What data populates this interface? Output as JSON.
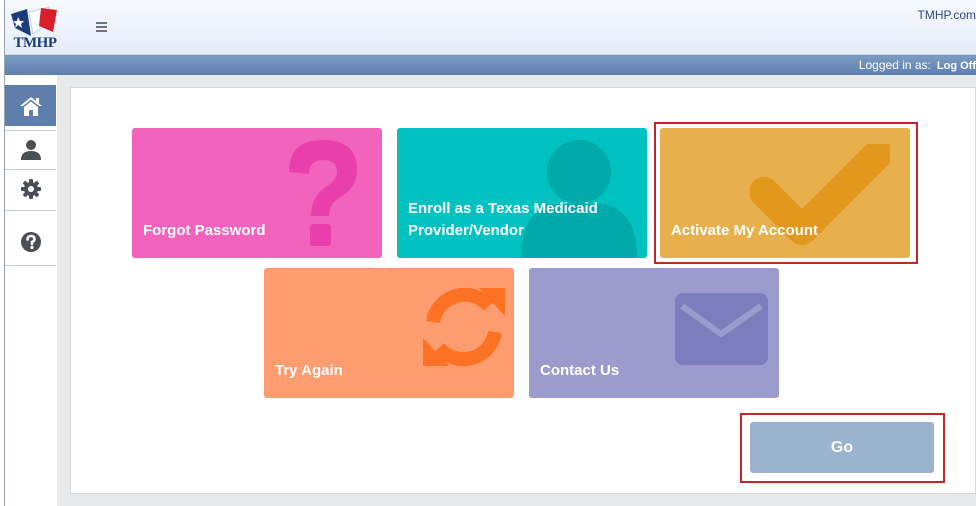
{
  "header": {
    "logo_text": "TMHP",
    "site_link": "TMHP.com"
  },
  "status_bar": {
    "logged_in_label": "Logged in as:",
    "log_off_label": "Log Off"
  },
  "sidenav": {
    "items": [
      {
        "name": "home",
        "icon": "home-icon",
        "active": true
      },
      {
        "name": "user",
        "icon": "user-icon",
        "active": false
      },
      {
        "name": "settings",
        "icon": "gear-icon",
        "active": false
      },
      {
        "name": "help",
        "icon": "question-icon",
        "active": false
      }
    ]
  },
  "tiles": {
    "forgot_password": {
      "label": "Forgot Password",
      "icon": "question-mark-icon",
      "color": "#f163bd"
    },
    "enroll": {
      "label_line1": "Enroll as a Texas Medicaid",
      "label_line2": "Provider/Vendor",
      "icon": "person-icon",
      "color": "#02c2c1"
    },
    "activate": {
      "label": "Activate My Account",
      "icon": "checkmark-icon",
      "color": "#e8b04d"
    },
    "try_again": {
      "label": "Try Again",
      "icon": "refresh-icon",
      "color": "#fd9c6e"
    },
    "contact_us": {
      "label": "Contact Us",
      "icon": "envelope-icon",
      "color": "#9b9bcd"
    }
  },
  "go_button": {
    "label": "Go",
    "color": "#9bb3cf"
  },
  "colors": {
    "highlight": "#c4262e",
    "status_bar": "#6a8bb6",
    "active_nav": "#5e7fac"
  }
}
